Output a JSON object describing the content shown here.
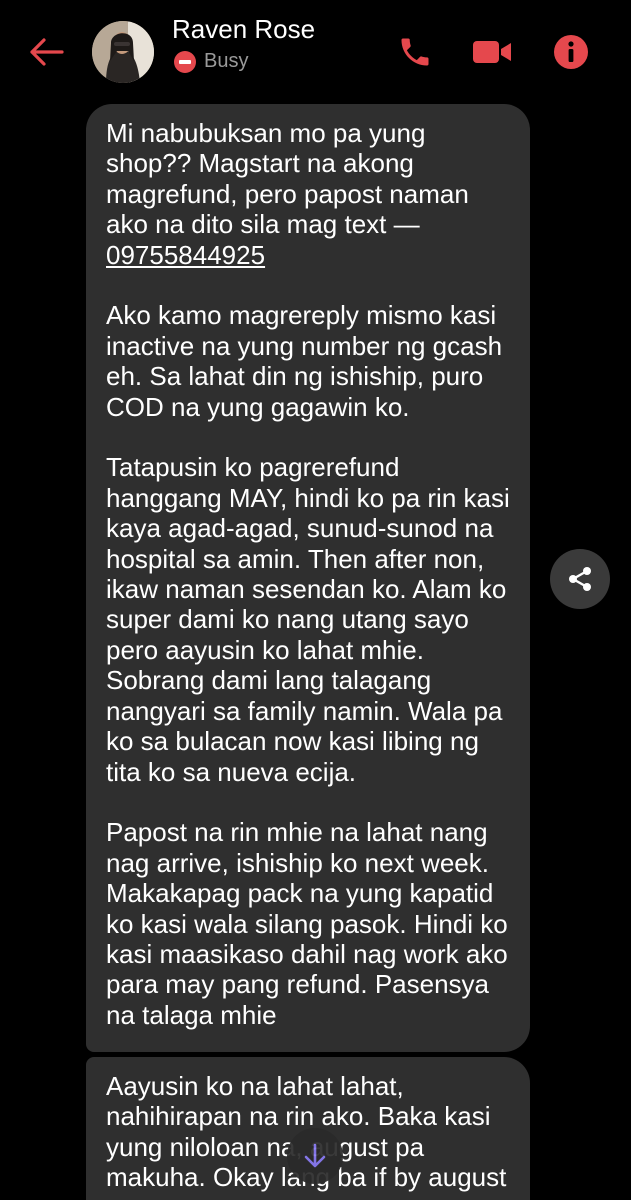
{
  "header": {
    "contact_name": "Raven Rose",
    "status": "Busy",
    "accent_color": "#e5484d",
    "icons": [
      "back-arrow-icon",
      "phone-icon",
      "video-camera-icon",
      "info-icon"
    ]
  },
  "messages": [
    {
      "paragraphs": [
        "Mi nabubuksan mo pa yung shop?? Magstart na akong magrefund, pero papost naman ako na dito sila mag text —",
        "Ako kamo magrereply mismo kasi inactive na yung number ng gcash eh. Sa lahat din ng ishiship, puro COD na yung gagawin ko.",
        "Tatapusin ko pagrerefund hanggang MAY, hindi ko pa rin kasi kaya agad-agad, sunud-sunod na hospital sa amin. Then after non, ikaw naman sesendan ko. Alam ko super dami ko nang utang sayo pero aayusin ko lahat mhie. Sobrang dami lang talagang nangyari sa family namin. Wala pa ko sa bulacan now kasi libing ng tita ko sa nueva ecija.",
        "Papost na rin mhie na lahat nang nag arrive, ishiship ko next week. Makakapag pack na yung kapatid ko kasi wala silang pasok. Hindi ko kasi maasikaso dahil nag work ako para may pang refund. Pasensya na talaga mhie"
      ],
      "phone_number": "09755844925"
    },
    {
      "text": "Aayusin ko na lahat lahat, nahihirapan na rin ako. Baka kasi yung niloloan na, august pa makuha. Okay lang ba if by august"
    }
  ],
  "floating": {
    "share_icon": "share-icon",
    "scroll_icon": "arrow-down-icon"
  }
}
